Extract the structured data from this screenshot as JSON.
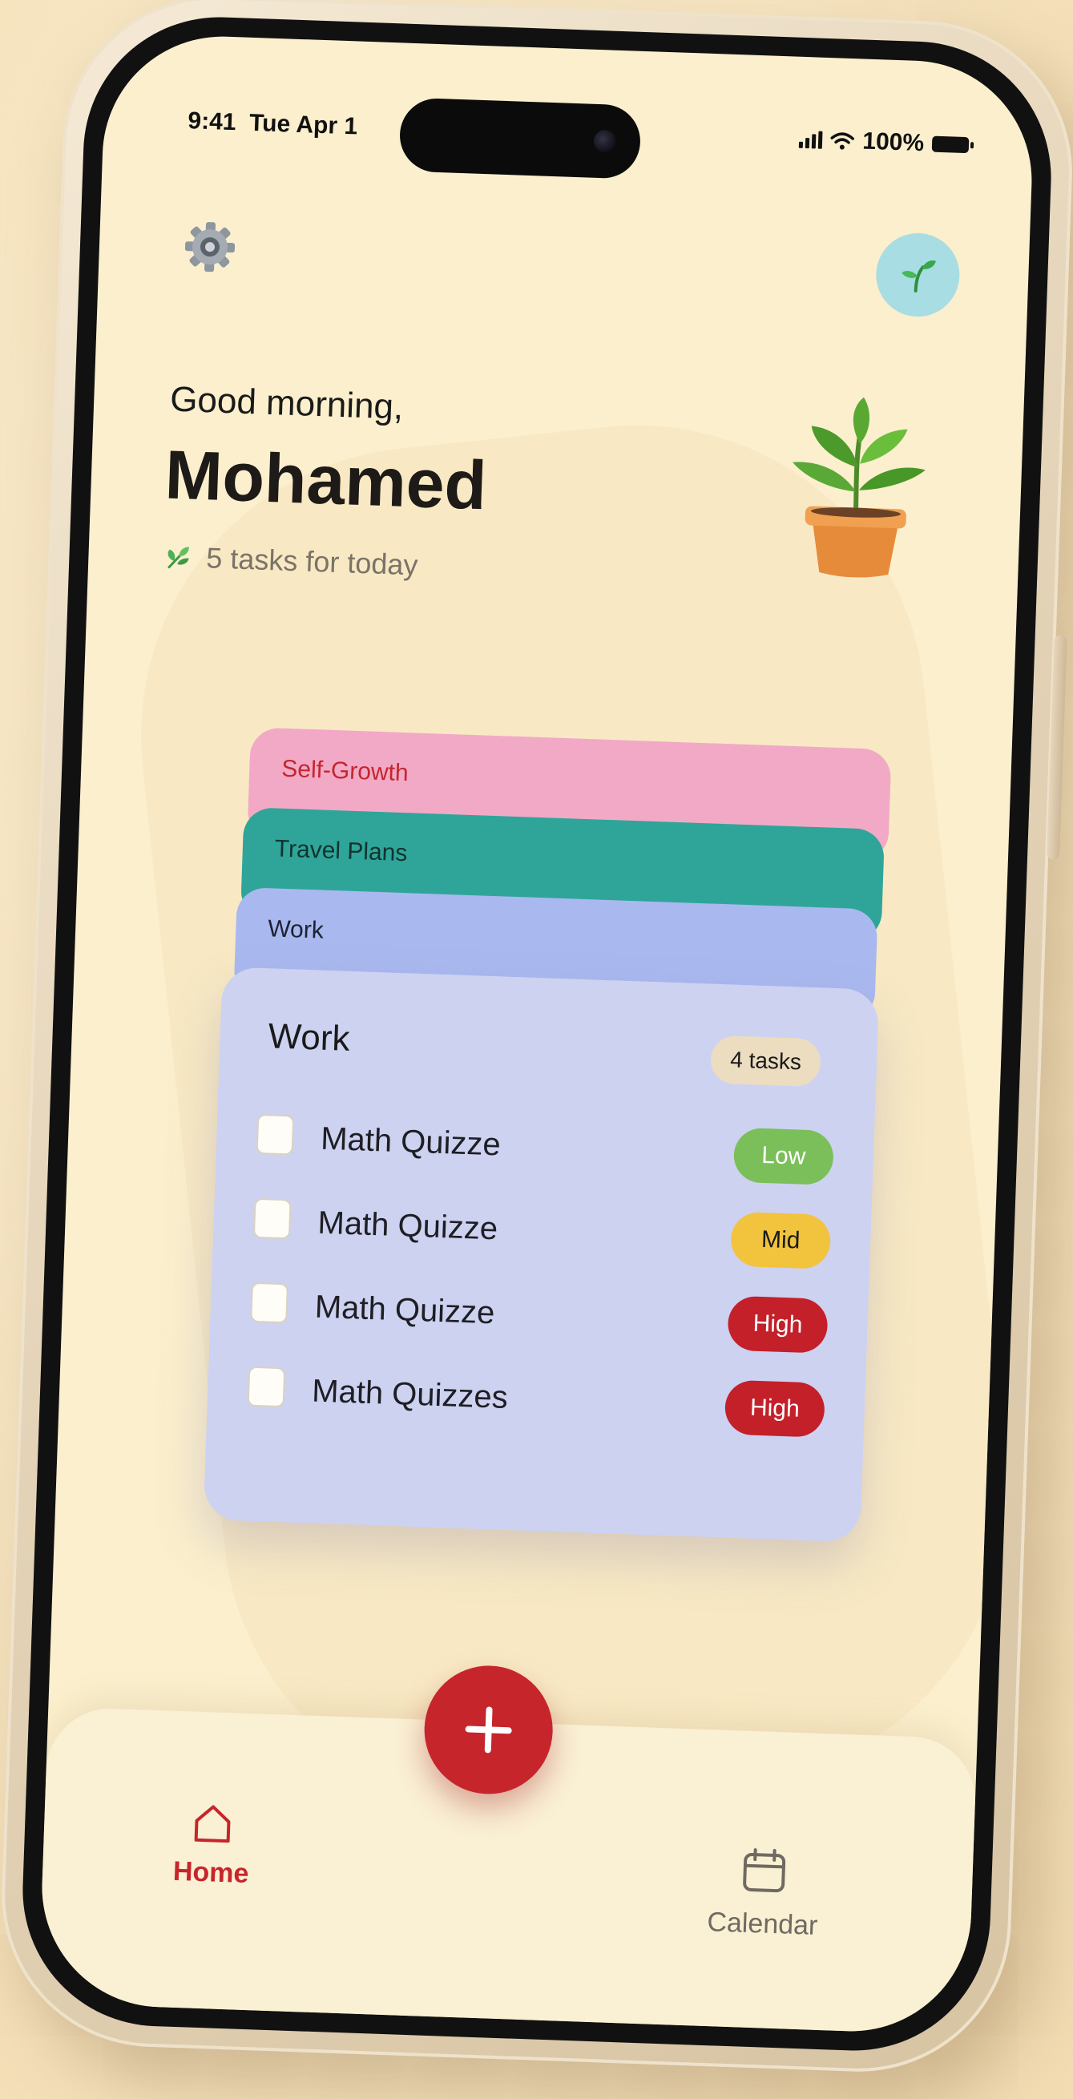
{
  "status_bar": {
    "time": "9:41",
    "date": "Tue Apr 1",
    "battery": "100%"
  },
  "header": {
    "settings_icon": "gear-icon",
    "avatar_icon": "sprout-icon",
    "greeting": "Good morning,",
    "name": "Mohamed",
    "tasks_summary": "5 tasks for today",
    "summary_icon": "leaf-icon",
    "illustration": "potted-plant"
  },
  "categories": [
    {
      "label": "Self-Growth",
      "color": "#f2a9c6"
    },
    {
      "label": "Travel Plans",
      "color": "#2fa59a"
    },
    {
      "label": "Work",
      "color": "#a9b9ef"
    }
  ],
  "active_list": {
    "title": "Work",
    "count": "4 tasks",
    "tasks": [
      {
        "name": "Math Quizze",
        "priority": "Low",
        "checked": false
      },
      {
        "name": "Math Quizze",
        "priority": "Mid",
        "checked": false
      },
      {
        "name": "Math Quizze",
        "priority": "High",
        "checked": false
      },
      {
        "name": "Math Quizzes",
        "priority": "High",
        "checked": false
      }
    ]
  },
  "bottom_nav": {
    "add_icon": "plus-icon",
    "items": [
      {
        "label": "Home",
        "icon": "home-icon",
        "active": true
      },
      {
        "label": "Calendar",
        "icon": "calendar-icon",
        "active": false
      }
    ]
  },
  "colors": {
    "accent": "#c6252c",
    "background": "#fbefcd",
    "low": "#7bbf5a",
    "mid": "#f2c33d",
    "high": "#c3202a"
  }
}
